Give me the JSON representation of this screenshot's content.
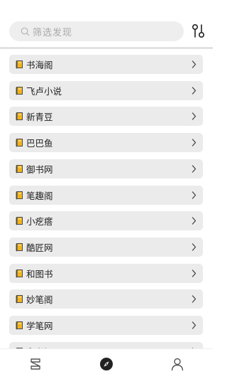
{
  "search": {
    "placeholder": "筛选发现"
  },
  "items": [
    {
      "label": "书海阁"
    },
    {
      "label": "飞卢小说"
    },
    {
      "label": "新青豆"
    },
    {
      "label": "巴巴鱼"
    },
    {
      "label": "御书网"
    },
    {
      "label": "笔趣阁"
    },
    {
      "label": "小疙瘩"
    },
    {
      "label": "酷匠网"
    },
    {
      "label": "和图书"
    },
    {
      "label": "妙笔阁"
    },
    {
      "label": "学笔网"
    },
    {
      "label": "郵书阁"
    }
  ],
  "tabs": [
    {
      "icon": "bookshelf-icon",
      "active": false
    },
    {
      "icon": "compass-icon",
      "active": true
    },
    {
      "icon": "user-icon",
      "active": false
    }
  ],
  "colors": {
    "book": "#f2b41c",
    "book_outline": "#4a4a4a",
    "bg_item": "#ebebeb"
  }
}
